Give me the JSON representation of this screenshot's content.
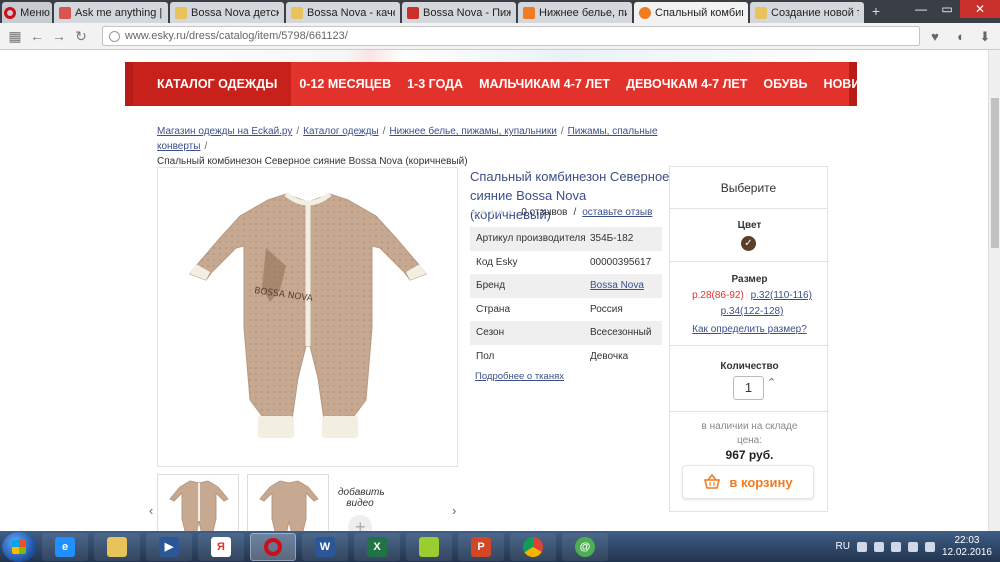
{
  "browser": {
    "menu_label": "Меню",
    "tabs": [
      {
        "title": "Ask me anything | a",
        "color": "#d9534f",
        "active": false
      },
      {
        "title": "Bossa Nova детский",
        "color": "#e8c25a",
        "active": false
      },
      {
        "title": "Bossa Nova - качес",
        "color": "#e8c25a",
        "active": false
      },
      {
        "title": "Bossa Nova - Пижам",
        "color": "#c9302c",
        "active": false
      },
      {
        "title": "Нижнее белье, пиж",
        "color": "#f07b22",
        "active": false
      },
      {
        "title": "Спальный комбин",
        "color": "#f07b22",
        "active": true
      },
      {
        "title": "Создание новой те",
        "color": "#e8c25a",
        "active": false
      }
    ],
    "url": "www.esky.ru/dress/catalog/item/5798/661123/"
  },
  "nav": {
    "items": [
      "КАТАЛОГ ОДЕЖДЫ",
      "0-12 МЕСЯЦЕВ",
      "1-3 ГОДА",
      "МАЛЬЧИКАМ 4-7 ЛЕТ",
      "ДЕВОЧКАМ 4-7 ЛЕТ",
      "ОБУВЬ",
      "НОВИНКИ"
    ]
  },
  "breadcrumbs": {
    "links": [
      "Магазин одежды на Еckай.ру",
      "Каталог одежды",
      "Нижнее белье, пижамы, купальники",
      "Пижамы, спальные конверты"
    ],
    "current": "Спальный комбинезон Северное сияние Bossa Nova (коричневый)"
  },
  "product": {
    "title": "Спальный комбинезон Северное сияние Bossa Nova (коричневый)",
    "reviews_count": "0 отзывов",
    "reviews_sep": "/",
    "leave_review": "оставьте отзыв",
    "props": [
      {
        "label": "Артикул производителя",
        "value": "354Б-182"
      },
      {
        "label": "Код Esky",
        "value": "00000395617"
      },
      {
        "label": "Бренд",
        "value": "Bossa Nova"
      },
      {
        "label": "Страна",
        "value": "Россия"
      },
      {
        "label": "Сезон",
        "value": "Всесезонный"
      },
      {
        "label": "Пол",
        "value": "Девочка"
      }
    ],
    "fabric_link": "Подробнее о тканях",
    "add_video": "добавить видео",
    "print_text": "BOSSA NOVA"
  },
  "buybox": {
    "heading": "Выберите",
    "color_label": "Цвет",
    "size_label": "Размер",
    "sizes": [
      "р.28(86-92)",
      "р.32(110-116)",
      "р.34(122-128)"
    ],
    "size_help": "Как определить размер?",
    "qty_label": "Количество",
    "qty": "1",
    "stock": "в наличии на складе",
    "price_label": "цена:",
    "price": "967 руб.",
    "cart_label": "в корзину"
  },
  "taskbar": {
    "lang": "RU",
    "time": "22:03",
    "date": "12.02.2016"
  },
  "colors": {
    "nav_red": "#e2322c",
    "link_blue": "#3c4f8a",
    "cart_orange": "#f07b22",
    "fabric": "#c7a891"
  }
}
